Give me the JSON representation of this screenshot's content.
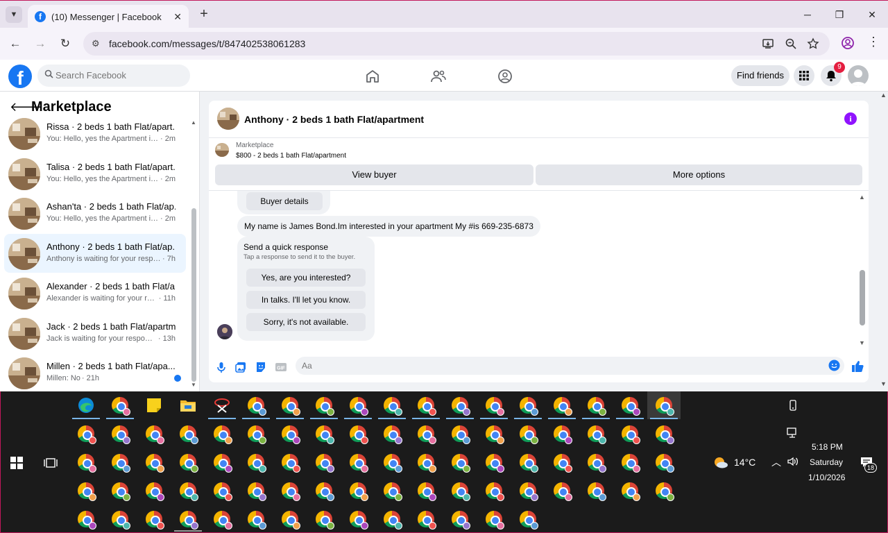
{
  "browser": {
    "tab_title": "(10) Messenger | Facebook",
    "url": "facebook.com/messages/t/847402538061283",
    "new_tab": "+",
    "close_tab": "✕",
    "window_minimize": "─",
    "window_restore": "❐",
    "window_close": "✕"
  },
  "fb": {
    "logo": "f",
    "search_placeholder": "Search Facebook",
    "find_friends": "Find friends",
    "notification_count": "9",
    "brand_color": "#1877f2"
  },
  "sidebar": {
    "title": "Marketplace",
    "conversations": [
      {
        "name": "Rissa · 2 beds 1 bath Flat/apart...",
        "preview": "You: Hello, yes the Apartment is st...",
        "time": "· 2m",
        "active": false,
        "unread": false
      },
      {
        "name": "Talisa · 2 beds 1 bath Flat/apart...",
        "preview": "You: Hello, yes the Apartment is st...",
        "time": "· 2m",
        "active": false,
        "unread": false
      },
      {
        "name": "Ashan'ta · 2 beds 1 bath Flat/ap...",
        "preview": "You: Hello, yes the Apartment is st...",
        "time": "· 2m",
        "active": false,
        "unread": false
      },
      {
        "name": "Anthony · 2 beds 1 bath Flat/ap...",
        "preview": "Anthony is waiting for your respon...",
        "time": "· 7h",
        "active": true,
        "unread": false
      },
      {
        "name": "Alexander · 2 beds 1 bath Flat/a...",
        "preview": "Alexander is waiting for your res...",
        "time": "· 11h",
        "active": false,
        "unread": false
      },
      {
        "name": "Jack · 2 beds 1 bath Flat/apartm...",
        "preview": "Jack is waiting for your response.",
        "time": "· 13h",
        "active": false,
        "unread": false
      },
      {
        "name": "Millen · 2 beds 1 bath Flat/apa...",
        "preview": "Millen: No",
        "time": "· 21h",
        "active": false,
        "unread": true
      }
    ]
  },
  "chat": {
    "title": "Anthony · 2 beds 1 bath Flat/apartment",
    "marketplace_label": "Marketplace",
    "listing": "$800 - 2 beds 1 bath Flat/apartment",
    "view_buyer": "View buyer",
    "more_options": "More options",
    "buyer_details": "Buyer details",
    "message": "My name is James Bond.Im interested in your apartment My #is 669-235-6873",
    "quick_title": "Send a quick response",
    "quick_subtitle": "Tap a response to send it to the buyer.",
    "quick_replies": [
      "Yes, are you interested?",
      "In talks. I'll let you know.",
      "Sorry, it's not available."
    ],
    "composer_placeholder": "Aa"
  },
  "taskbar": {
    "weather": "14°C",
    "time": "5:18 PM",
    "day": "Saturday",
    "date": "1/10/2026",
    "notifications": "18"
  }
}
